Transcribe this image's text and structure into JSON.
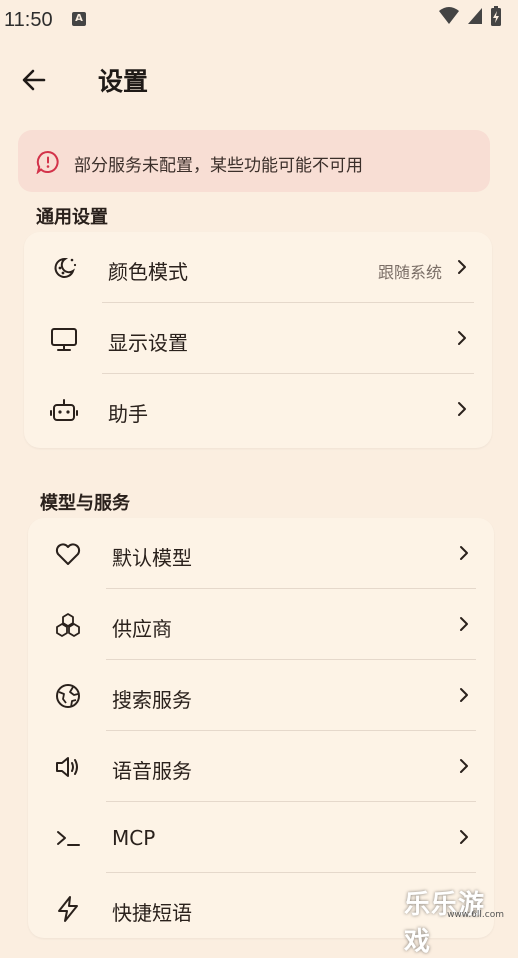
{
  "status": {
    "time": "11:50",
    "notif_glyph": "A"
  },
  "header": {
    "title": "设置"
  },
  "warning": {
    "text": "部分服务未配置，某些功能可能不可用",
    "color": "#d3334a"
  },
  "general": {
    "title": "通用设置",
    "items": [
      {
        "label": "颜色模式",
        "value": "跟随系统",
        "icon": "palette-icon"
      },
      {
        "label": "显示设置",
        "icon": "monitor-icon"
      },
      {
        "label": "助手",
        "icon": "robot-icon"
      }
    ]
  },
  "models": {
    "title": "模型与服务",
    "items": [
      {
        "label": "默认模型",
        "icon": "heart-icon"
      },
      {
        "label": "供应商",
        "icon": "cubes-icon"
      },
      {
        "label": "搜索服务",
        "icon": "globe-icon"
      },
      {
        "label": "语音服务",
        "icon": "speaker-icon"
      },
      {
        "label": "MCP",
        "icon": "terminal-icon"
      },
      {
        "label": "快捷短语",
        "icon": "bolt-icon"
      }
    ]
  },
  "watermark": {
    "text": "乐乐游戏",
    "url": "www.6ll.com"
  }
}
